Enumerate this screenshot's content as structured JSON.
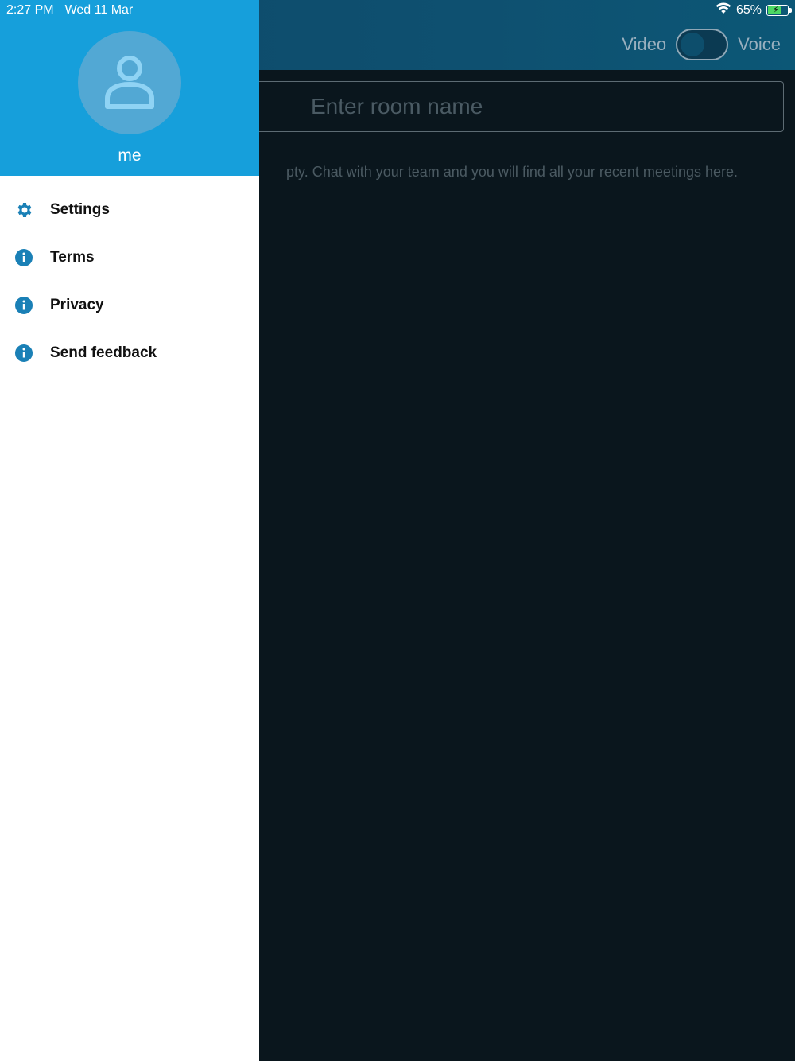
{
  "status_bar": {
    "time": "2:27 PM",
    "date": "Wed 11 Mar",
    "battery": "65%",
    "battery_level": 0.65,
    "wifi_icon": "wifi-icon",
    "battery_icon": "battery-charging-icon"
  },
  "main": {
    "mode_left_label": "Video",
    "mode_right_label": "Voice",
    "room_placeholder": "Enter room name",
    "empty_message": "pty. Chat with your team and you will find all your recent meetings here."
  },
  "drawer": {
    "user_name": "me",
    "avatar_icon": "user-icon",
    "accent_color": "#169fdb",
    "items": [
      {
        "label": "Settings",
        "icon": "gear-icon"
      },
      {
        "label": "Terms",
        "icon": "info-icon"
      },
      {
        "label": "Privacy",
        "icon": "info-icon"
      },
      {
        "label": "Send feedback",
        "icon": "info-icon"
      }
    ]
  }
}
